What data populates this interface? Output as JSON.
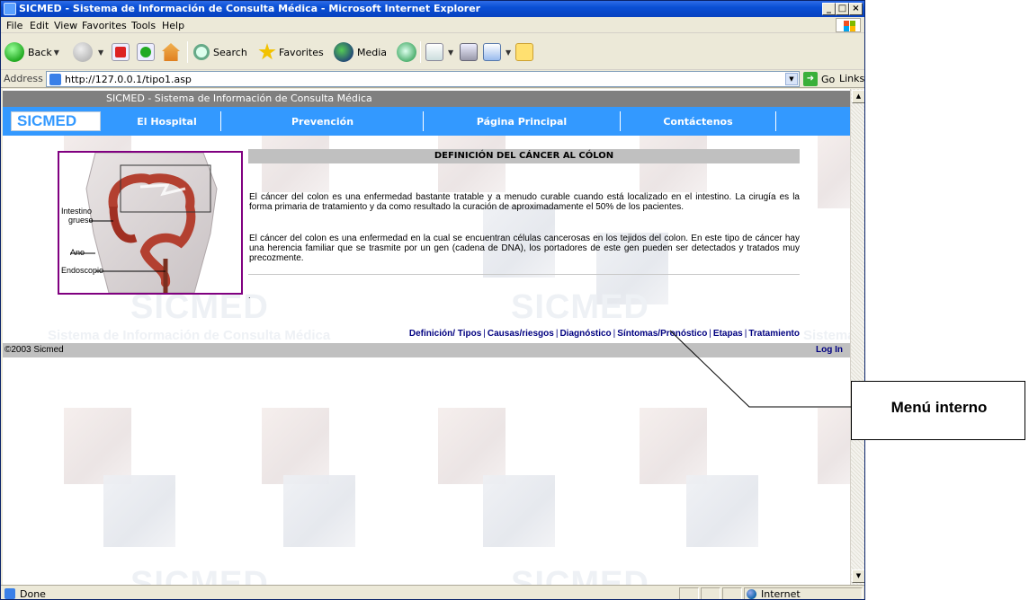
{
  "window": {
    "title": "SICMED - Sistema de Información de Consulta Médica - Microsoft Internet Explorer",
    "controls": [
      "_",
      "□",
      "×"
    ]
  },
  "menubar": [
    "File",
    "Edit",
    "View",
    "Favorites",
    "Tools",
    "Help"
  ],
  "toolbar": {
    "back": "Back",
    "search": "Search",
    "favorites": "Favorites",
    "media": "Media"
  },
  "address": {
    "label": "Address",
    "url": "http://127.0.0.1/tipo1.asp",
    "go": "Go",
    "links": "Links »"
  },
  "site": {
    "title": "SICMED - Sistema de Información de Consulta Médica",
    "logo": "SICMED",
    "nav": [
      "El Hospital",
      "Prevención",
      "Página Principal",
      "Contáctenos"
    ],
    "watermark_word": "SICMED",
    "watermark_sub": "Sistema de Información de Consulta Médica"
  },
  "illustration": {
    "labels": {
      "intestine_1": "Intestino",
      "intestine_2": "grueso",
      "anus": "Ano",
      "scope": "Endoscopio"
    }
  },
  "article": {
    "title": "DEFINICIÓN DEL CÁNCER AL CÓLON",
    "paragraph_1": "El cáncer del colon es una enfermedad bastante tratable y a menudo curable cuando está localizado en el intestino. La cirugía es la forma primaria de tratamiento y da como resultado la curación de aproximadamente el 50% de los pacientes.",
    "paragraph_2": "El cáncer del colon es una enfermedad en la cual se encuentran células cancerosas en los tejidos del colon. En este tipo de cáncer hay una herencia familiar que se trasmite por un gen (cadena de DNA), los portadores de este gen pueden ser detectados y tratados muy precozmente.",
    "dot": "."
  },
  "internal_menu": [
    "Definición/ Tipos",
    "Causas/riesgos",
    "Diagnóstico",
    "Síntomas/Pronóstico",
    "Etapas",
    "Tratamiento"
  ],
  "footer": {
    "copyright": "©2003 Sicmed",
    "login": "Log In"
  },
  "status": {
    "text": "Done",
    "zone": "Internet"
  },
  "callout": {
    "label": "Menú interno"
  },
  "colors": {
    "nav_blue": "#3399ff",
    "header_gray": "#808080",
    "frame_purple": "#800080",
    "link_navy": "#000080"
  }
}
